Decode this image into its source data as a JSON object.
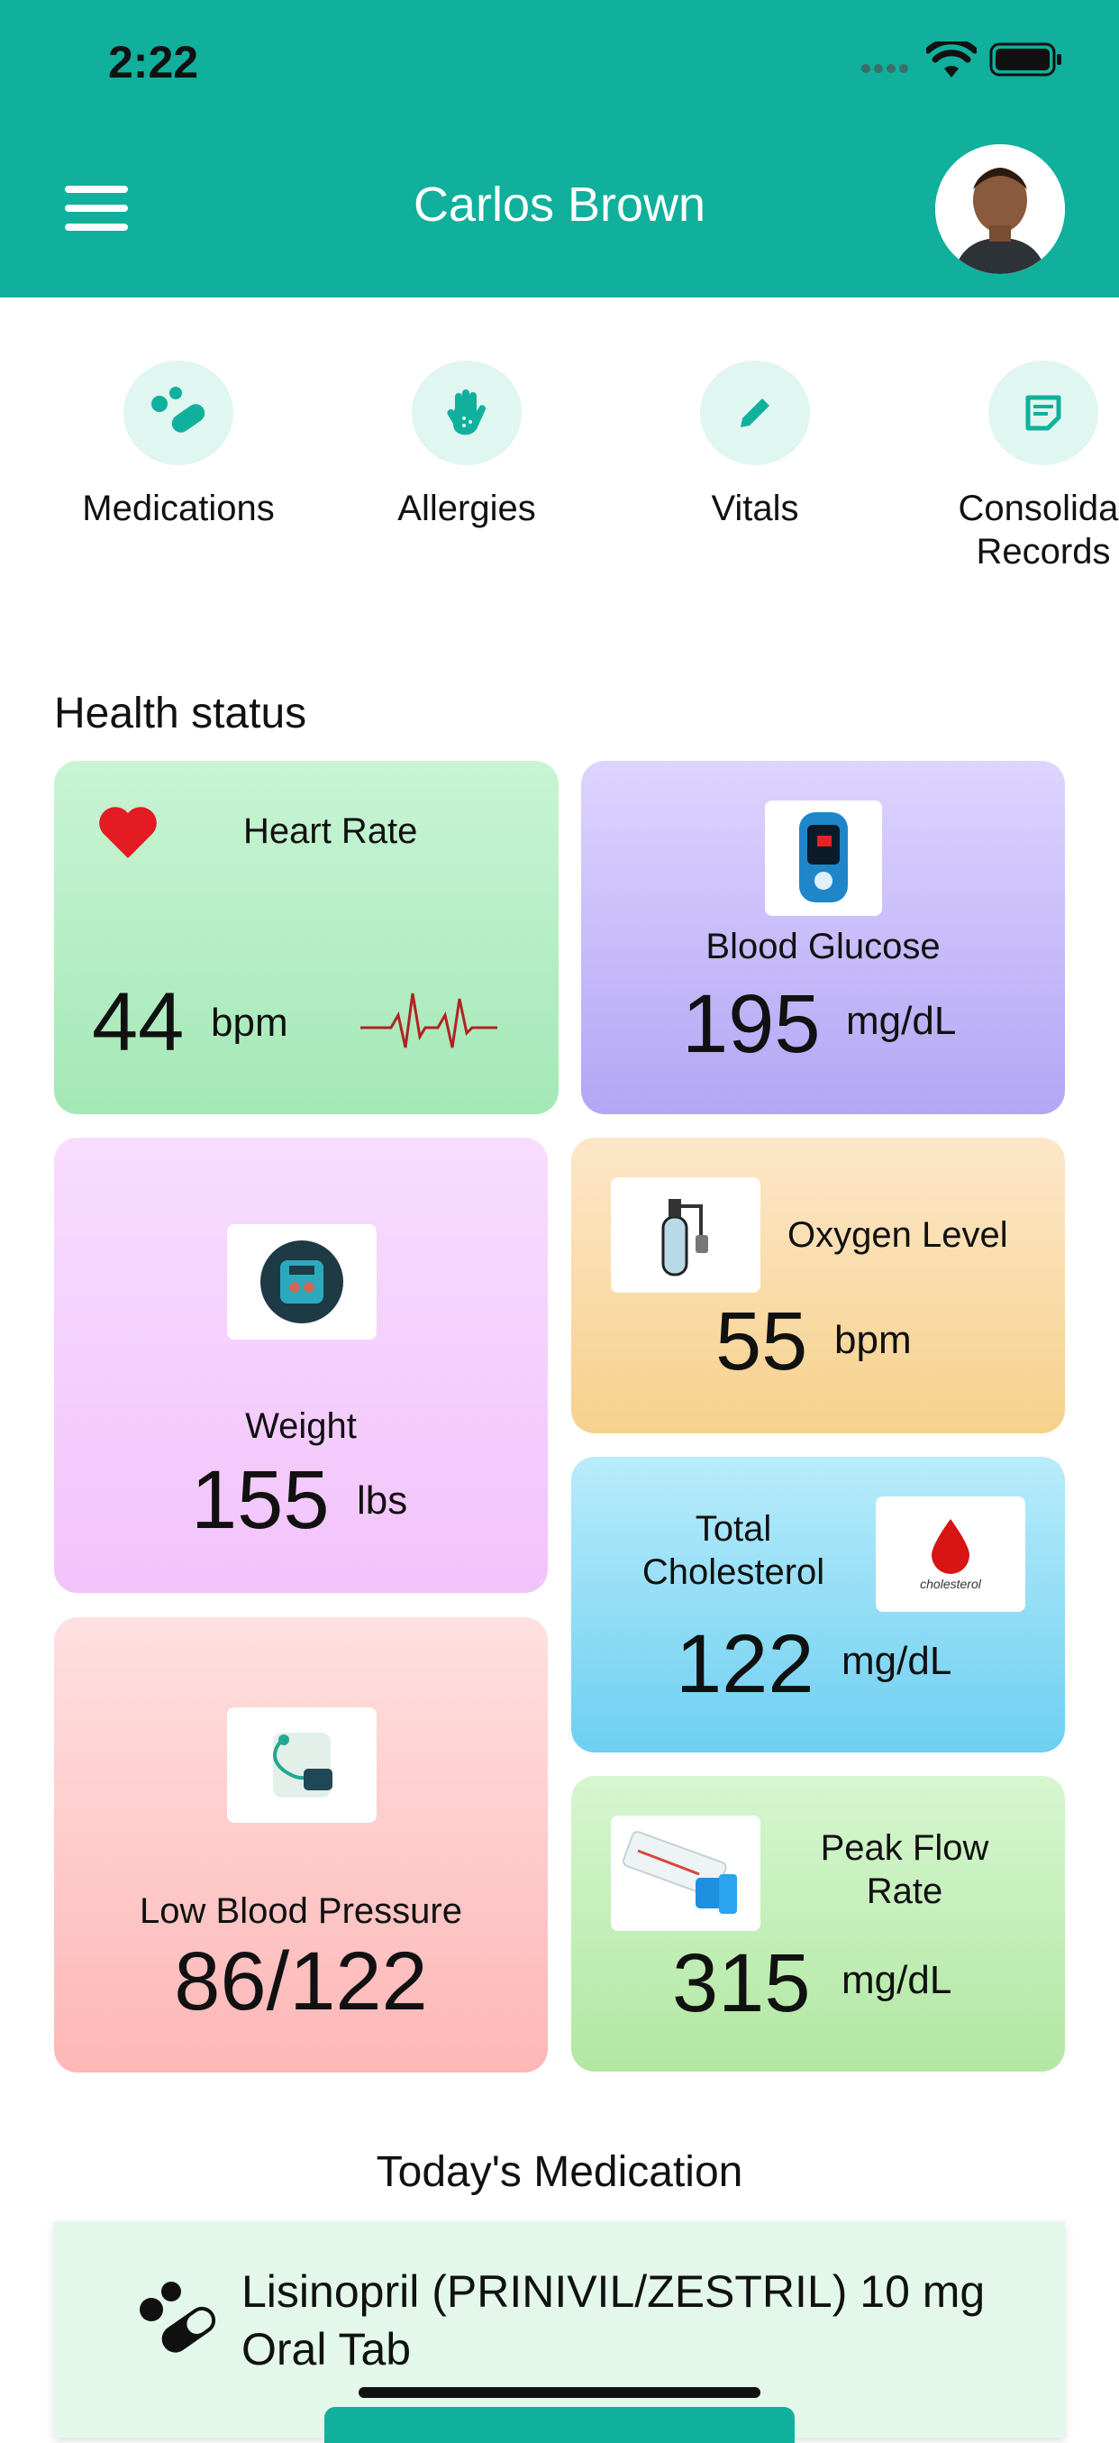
{
  "status_bar": {
    "time": "2:22"
  },
  "header": {
    "title": "Carlos Brown"
  },
  "quick_actions": [
    {
      "label": "Medications",
      "icon": "pills-icon"
    },
    {
      "label": "Allergies",
      "icon": "hand-icon"
    },
    {
      "label": "Vitals",
      "icon": "pencil-icon"
    },
    {
      "label": "Consolidated Records",
      "label_line1": "Consolidat",
      "label_line2": "Records",
      "icon": "note-icon"
    }
  ],
  "health": {
    "title": "Health status",
    "heart_rate": {
      "label": "Heart Rate",
      "value": "44",
      "unit": "bpm"
    },
    "blood_glucose": {
      "label": "Blood Glucose",
      "value": "195",
      "unit": "mg/dL"
    },
    "weight": {
      "label": "Weight",
      "value": "155",
      "unit": "lbs"
    },
    "oxygen_level": {
      "label": "Oxygen Level",
      "value": "55",
      "unit": "bpm"
    },
    "total_cholesterol": {
      "label_line1": "Total",
      "label_line2": "Cholesterol",
      "value": "122",
      "unit": "mg/dL",
      "badge_text": "cholesterol"
    },
    "low_blood_pressure": {
      "label": "Low Blood Pressure",
      "value": "86/122"
    },
    "peak_flow_rate": {
      "label_line1": "Peak Flow",
      "label_line2": "Rate",
      "value": "315",
      "unit": "mg/dL"
    }
  },
  "today_medication": {
    "title": "Today's Medication",
    "items": [
      {
        "name": "Lisinopril (PRINIVIL/ZESTRIL) 10 mg Oral Tab"
      }
    ]
  },
  "colors": {
    "brand": "#10B09C",
    "heart": "#E41B23",
    "ecg": "#B22222"
  }
}
